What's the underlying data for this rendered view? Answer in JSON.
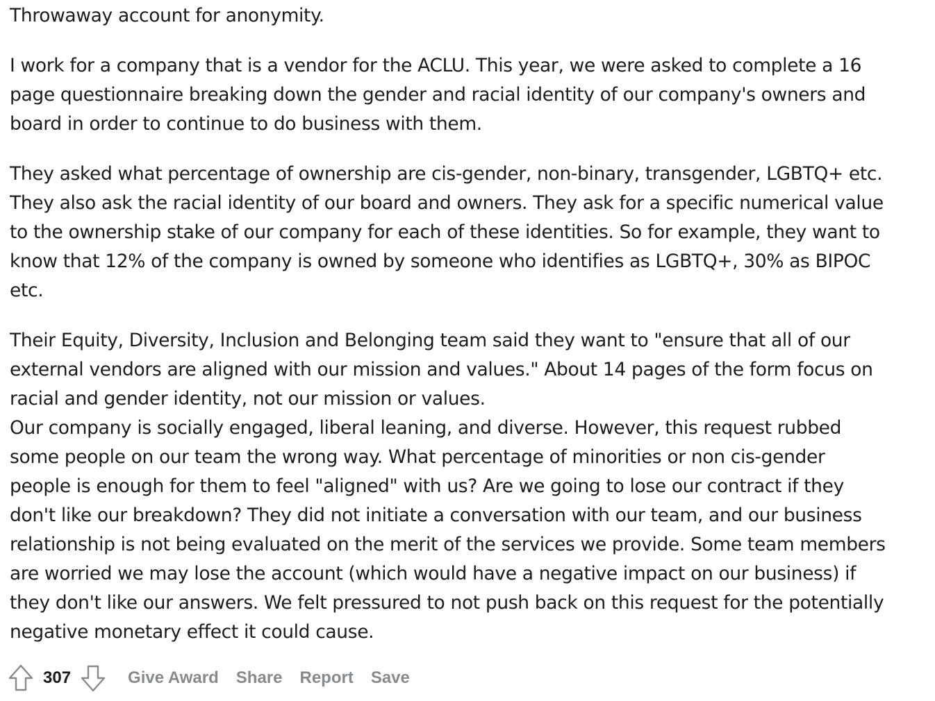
{
  "post": {
    "paragraphs": [
      "Throwaway account for anonymity.",
      "I work for a company that is a vendor for the ACLU. This year, we were asked to complete a 16\npage questionnaire breaking down the gender and racial identity of our company's owners and\nboard in order to continue to do business with them.",
      "They asked what percentage of ownership are cis-gender, non-binary, transgender, LGBTQ+ etc.\nThey also ask the racial identity of our board and owners. They ask for a specific numerical value\nto the ownership stake of our company for each of these identities. So for example, they want to\nknow that 12% of the company is owned by someone who identifies as LGBTQ+, 30% as BIPOC\netc.",
      "Their Equity, Diversity, Inclusion and Belonging team said they want to  \"ensure that all of our\nexternal vendors are aligned with our mission and values.\" About 14 pages of the form focus on\nracial and gender identity, not our mission or values.",
      "Our company is socially engaged, liberal leaning, and diverse. However, this request rubbed\nsome people on our team the wrong way. What percentage of minorities or non cis-gender\npeople is enough for them to feel \"aligned\" with us? Are we going to lose our contract if they\ndon't like our breakdown? They did not initiate a conversation with our team, and our business\nrelationship is not being evaluated on the merit of the services we provide. Some team members\nare worried we may lose the account (which would have a negative impact on our business) if\nthey don't like our answers. We felt pressured to not push back on this request for the potentially\nnegative monetary effect it could cause."
    ]
  },
  "actions": {
    "upvote_icon": "arrow-up-outline-icon",
    "downvote_icon": "arrow-down-outline-icon",
    "vote_count": "307",
    "give_award": "Give Award",
    "share": "Share",
    "report": "Report",
    "save": "Save"
  },
  "colors": {
    "text": "#1c1c1c",
    "action_gray": "#878a8c",
    "icon_gray": "#878a8c"
  }
}
